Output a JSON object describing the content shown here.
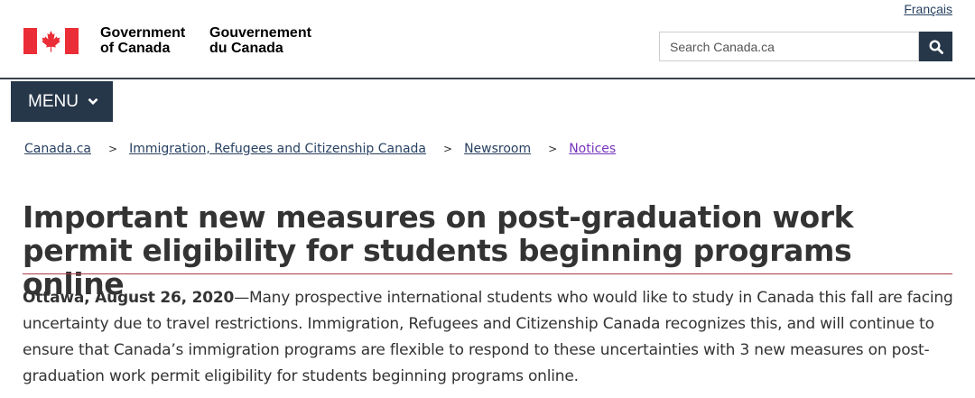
{
  "header": {
    "language_toggle": "Français",
    "signature_en": [
      "Government",
      "of Canada"
    ],
    "signature_fr": [
      "Gouvernement",
      "du Canada"
    ],
    "search_placeholder": "Search Canada.ca",
    "flag_icon": "canada-flag-icon",
    "search_icon": "search-icon",
    "colors": {
      "flag_red": "#eb2d37",
      "nav_blue": "#26374a",
      "link": "#284162",
      "visited": "#7834bc",
      "title_rule": "#af3c43"
    }
  },
  "menu": {
    "label": "MENU",
    "icon": "chevron-down-icon"
  },
  "breadcrumb": [
    {
      "label": "Canada.ca"
    },
    {
      "label": "Immigration, Refugees and Citizenship Canada"
    },
    {
      "label": "Newsroom"
    },
    {
      "label": "Notices"
    }
  ],
  "article": {
    "title": "Important new measures on post-graduation work permit eligibility for students beginning programs online",
    "dateline": "Ottawa, August 26, 2020",
    "lead": "—Many prospective international students who would like to study in Canada this fall are facing uncertainty due to travel restrictions. Immigration, Refugees and Citizenship Canada recognizes this, and will continue to ensure that Canada’s immigration programs are flexible to respond to these uncertainties with 3 new measures on post-graduation work permit eligibility for students beginning programs online."
  }
}
